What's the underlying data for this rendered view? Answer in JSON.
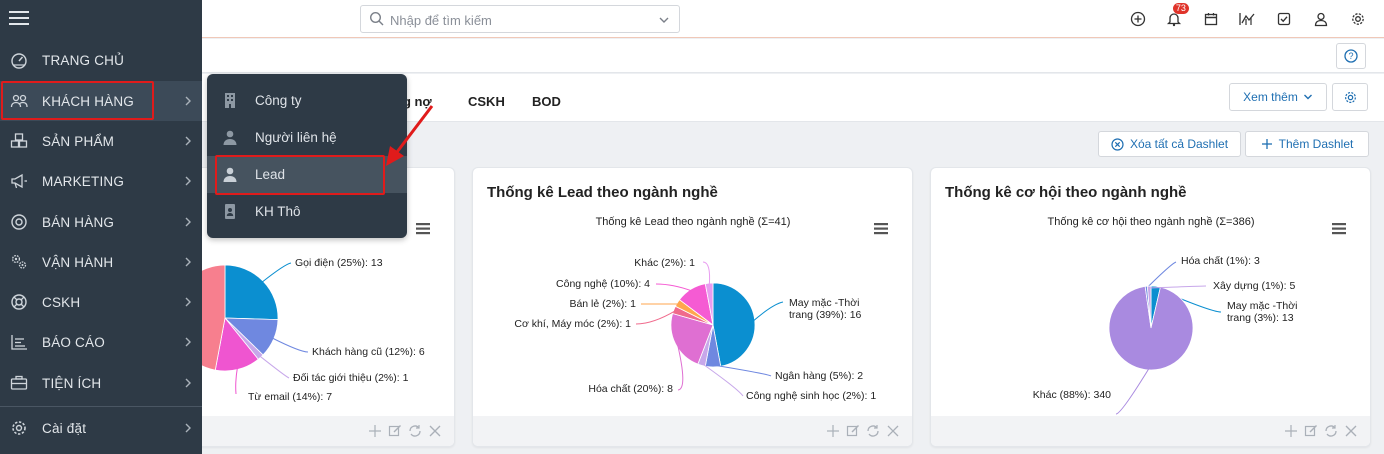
{
  "search": {
    "placeholder": "Nhập để tìm kiếm"
  },
  "topbar": {
    "notification_count": "73",
    "icons": [
      "add-circle-icon",
      "bell-icon",
      "calendar-icon",
      "chart-icon",
      "checkbox-icon",
      "user-icon",
      "gear-icon"
    ]
  },
  "tabs": [
    {
      "label": "ng nợ"
    },
    {
      "label": "CSKH"
    },
    {
      "label": "BOD"
    }
  ],
  "toolbar": {
    "more_label": "Xem thêm",
    "clear_dashlets_label": "Xóa tất cả Dashlet",
    "add_dashlet_label": "Thêm Dashlet"
  },
  "sidebar": {
    "items": [
      {
        "label": "TRANG CHỦ",
        "icon": "dashboard-icon"
      },
      {
        "label": "KHÁCH HÀNG",
        "icon": "customers-icon"
      },
      {
        "label": "SẢN PHẨM",
        "icon": "products-icon"
      },
      {
        "label": "MARKETING",
        "icon": "megaphone-icon"
      },
      {
        "label": "BÁN HÀNG",
        "icon": "target-icon"
      },
      {
        "label": "VẬN HÀNH",
        "icon": "cogs-icon"
      },
      {
        "label": "CSKH",
        "icon": "lifebuoy-icon"
      },
      {
        "label": "BÁO CÁO",
        "icon": "report-icon"
      },
      {
        "label": "TIỆN ÍCH",
        "icon": "toolbox-icon"
      },
      {
        "label": "Cài đặt",
        "icon": "settings-icon"
      }
    ]
  },
  "submenu": {
    "items": [
      {
        "label": "Công ty",
        "icon": "building-icon"
      },
      {
        "label": "Người liên hệ",
        "icon": "contact-icon"
      },
      {
        "label": "Lead",
        "icon": "person-icon"
      },
      {
        "label": "KH Thô",
        "icon": "badge-icon"
      }
    ]
  },
  "colors": {
    "sidebar": "#2e3a46",
    "accent": "#1f6fb2",
    "highlight": "#e01b1b"
  },
  "chart_data": [
    {
      "type": "pie",
      "title": "",
      "series": [
        {
          "label": "Gọi điện (25%): 13",
          "value": 13,
          "color": "#0b8fd0"
        },
        {
          "label": "Khách hàng cũ (12%): 6",
          "value": 6,
          "color": "#6f88e0"
        },
        {
          "label": "Đối tác giới thiệu (2%): 1",
          "value": 1,
          "color": "#c7a7ea"
        },
        {
          "label": "Từ email (14%): 7",
          "value": 7,
          "color": "#ef55d0"
        },
        {
          "label": "",
          "value": 24,
          "color": "#f77f8e"
        }
      ]
    },
    {
      "type": "pie",
      "card_title": "Thống kê Lead theo ngành nghề",
      "title": "Thống kê Lead theo ngành nghề (Σ=41)",
      "series": [
        {
          "label": "May mặc - Thời trang (39%): 16",
          "value": 16,
          "color": "#0b8fd0"
        },
        {
          "label": "Ngân hàng (5%): 2",
          "value": 2,
          "color": "#6f88e0"
        },
        {
          "label": "Công nghệ sinh học (2%): 1",
          "value": 1,
          "color": "#c7a7ea"
        },
        {
          "label": "Hóa chất (20%): 8",
          "value": 8,
          "color": "#df6fd2"
        },
        {
          "label": "Cơ khí, Máy móc (2%): 1",
          "value": 1,
          "color": "#f06a8c"
        },
        {
          "label": "Bán lẻ (2%): 1",
          "value": 1,
          "color": "#ffa64d"
        },
        {
          "label": "Công nghệ (10%): 4",
          "value": 4,
          "color": "#f55bd3"
        },
        {
          "label": "Khác (2%): 1",
          "value": 1,
          "color": "#e89cf0"
        }
      ]
    },
    {
      "type": "pie",
      "card_title": "Thống kê cơ hội theo ngành nghề",
      "title": "Thống kê cơ hội theo ngành nghề (Σ=386)",
      "series": [
        {
          "label": "May mặc - Thời trang (3%): 13",
          "value": 13,
          "color": "#0b8fd0"
        },
        {
          "label": "Khác (88%): 340",
          "value": 340,
          "color": "#a98ae0"
        },
        {
          "label": "Hóa chất (1%): 3",
          "value": 3,
          "color": "#6f88e0"
        },
        {
          "label": "Xây dựng (1%): 5",
          "value": 5,
          "color": "#c7a7ea"
        }
      ]
    }
  ]
}
